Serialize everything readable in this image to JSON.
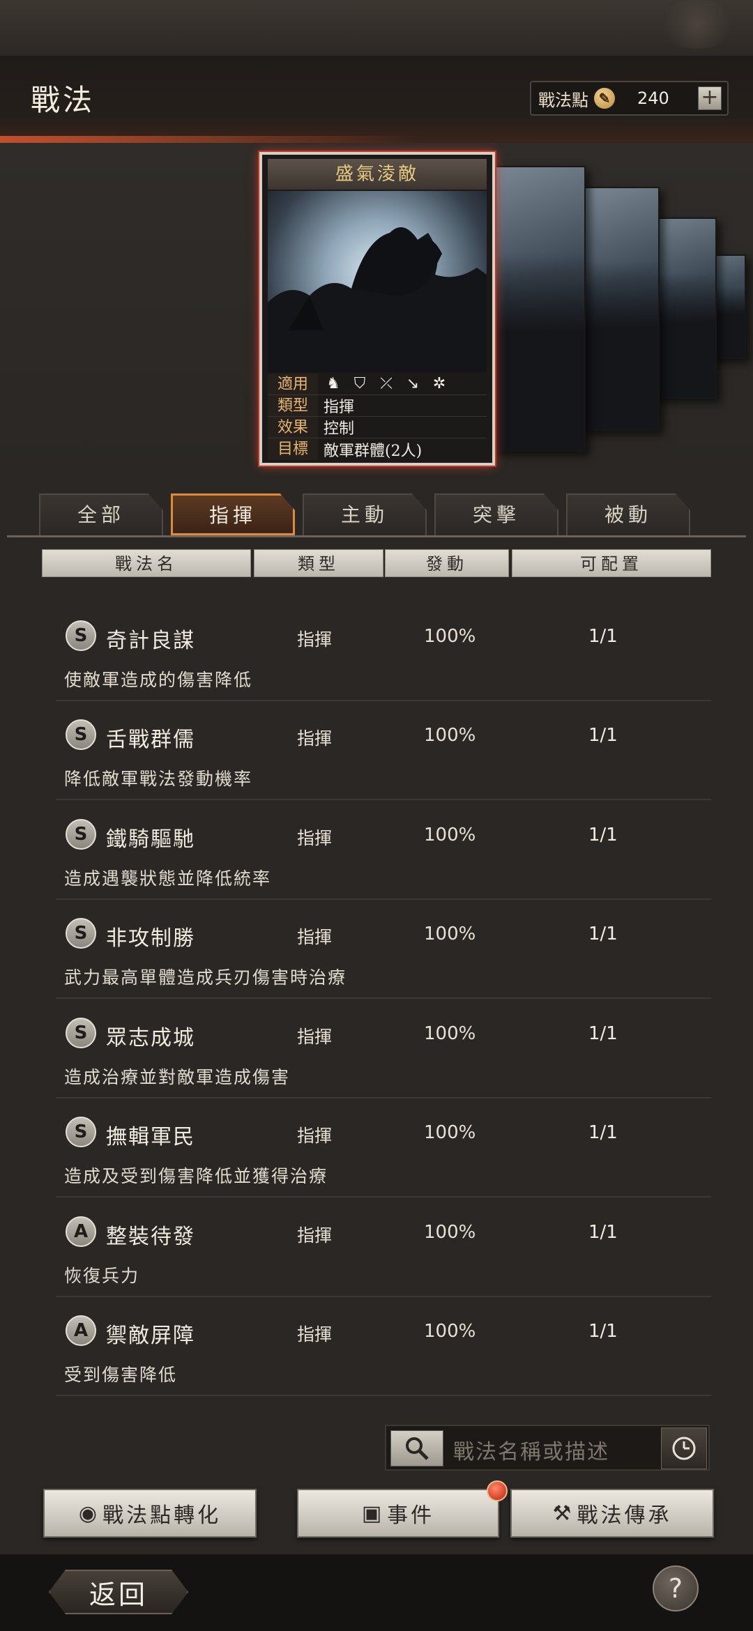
{
  "header": {
    "title": "戰法",
    "points_label": "戰法點",
    "points_value": "240",
    "plus_icon": "+"
  },
  "card": {
    "title": "盛氣淩敵",
    "rows": [
      {
        "key": "適用",
        "icons": [
          "cavalry-icon",
          "shield-icon",
          "bow-icon",
          "spear-icon",
          "siege-icon"
        ]
      },
      {
        "key": "類型",
        "value": "指揮"
      },
      {
        "key": "效果",
        "value": "控制"
      },
      {
        "key": "目標",
        "value": "敵軍群體(2人)"
      }
    ]
  },
  "tabs": [
    {
      "label": "全部",
      "active": false
    },
    {
      "label": "指揮",
      "active": true
    },
    {
      "label": "主動",
      "active": false
    },
    {
      "label": "突擊",
      "active": false
    },
    {
      "label": "被動",
      "active": false
    }
  ],
  "columns": [
    "戰法名",
    "類型",
    "發動",
    "可配置"
  ],
  "tactics": [
    {
      "grade": "S",
      "name": "奇計良謀",
      "type": "指揮",
      "rate": "100%",
      "avail": "1/1",
      "desc": "使敵軍造成的傷害降低"
    },
    {
      "grade": "S",
      "name": "舌戰群儒",
      "type": "指揮",
      "rate": "100%",
      "avail": "1/1",
      "desc": "降低敵軍戰法發動機率"
    },
    {
      "grade": "S",
      "name": "鐵騎驅馳",
      "type": "指揮",
      "rate": "100%",
      "avail": "1/1",
      "desc": "造成遇襲狀態並降低統率"
    },
    {
      "grade": "S",
      "name": "非攻制勝",
      "type": "指揮",
      "rate": "100%",
      "avail": "1/1",
      "desc": "武力最高單體造成兵刃傷害時治療"
    },
    {
      "grade": "S",
      "name": "眾志成城",
      "type": "指揮",
      "rate": "100%",
      "avail": "1/1",
      "desc": "造成治療並對敵軍造成傷害"
    },
    {
      "grade": "S",
      "name": "撫輯軍民",
      "type": "指揮",
      "rate": "100%",
      "avail": "1/1",
      "desc": "造成及受到傷害降低並獲得治療"
    },
    {
      "grade": "A",
      "name": "整裝待發",
      "type": "指揮",
      "rate": "100%",
      "avail": "1/1",
      "desc": "恢復兵力"
    },
    {
      "grade": "A",
      "name": "禦敵屏障",
      "type": "指揮",
      "rate": "100%",
      "avail": "1/1",
      "desc": "受到傷害降低"
    }
  ],
  "search": {
    "placeholder": "戰法名稱或描述"
  },
  "buttons": {
    "convert": "戰法點轉化",
    "events": "事件",
    "inherit": "戰法傳承"
  },
  "footer": {
    "back": "返回",
    "help": "?"
  },
  "colors": {
    "accent_orange": "#e08a3b",
    "card_glow": "#c33a2a",
    "gold_text": "#e6c97e"
  }
}
